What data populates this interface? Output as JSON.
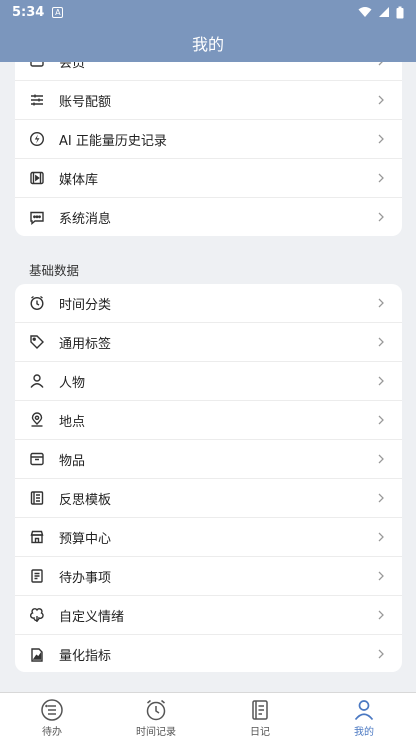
{
  "status_bar": {
    "time": "5:34"
  },
  "app_bar": {
    "title": "我的"
  },
  "group1": {
    "items": [
      {
        "label": "会员",
        "icon": "member-icon"
      },
      {
        "label": "账号配额",
        "icon": "sliders-icon"
      },
      {
        "label": "AI 正能量历史记录",
        "icon": "bolt-icon"
      },
      {
        "label": "媒体库",
        "icon": "media-icon"
      },
      {
        "label": "系统消息",
        "icon": "message-icon"
      }
    ]
  },
  "group2": {
    "title": "基础数据",
    "items": [
      {
        "label": "时间分类",
        "icon": "clock-icon"
      },
      {
        "label": "通用标签",
        "icon": "tag-icon"
      },
      {
        "label": "人物",
        "icon": "person-icon"
      },
      {
        "label": "地点",
        "icon": "location-icon"
      },
      {
        "label": "物品",
        "icon": "box-icon"
      },
      {
        "label": "反思模板",
        "icon": "template-icon"
      },
      {
        "label": "预算中心",
        "icon": "store-icon"
      },
      {
        "label": "待办事项",
        "icon": "todo-icon"
      },
      {
        "label": "自定义情绪",
        "icon": "emotion-icon"
      },
      {
        "label": "量化指标",
        "icon": "chart-icon"
      }
    ]
  },
  "bottom_nav": {
    "tabs": [
      {
        "label": "待办",
        "icon": "list-icon"
      },
      {
        "label": "时间记录",
        "icon": "alarm-icon"
      },
      {
        "label": "日记",
        "icon": "notebook-icon"
      },
      {
        "label": "我的",
        "icon": "profile-icon"
      }
    ],
    "active_color": "#4a78c2"
  },
  "colors": {
    "header": "#7b96bd",
    "background": "#eef0f3"
  }
}
